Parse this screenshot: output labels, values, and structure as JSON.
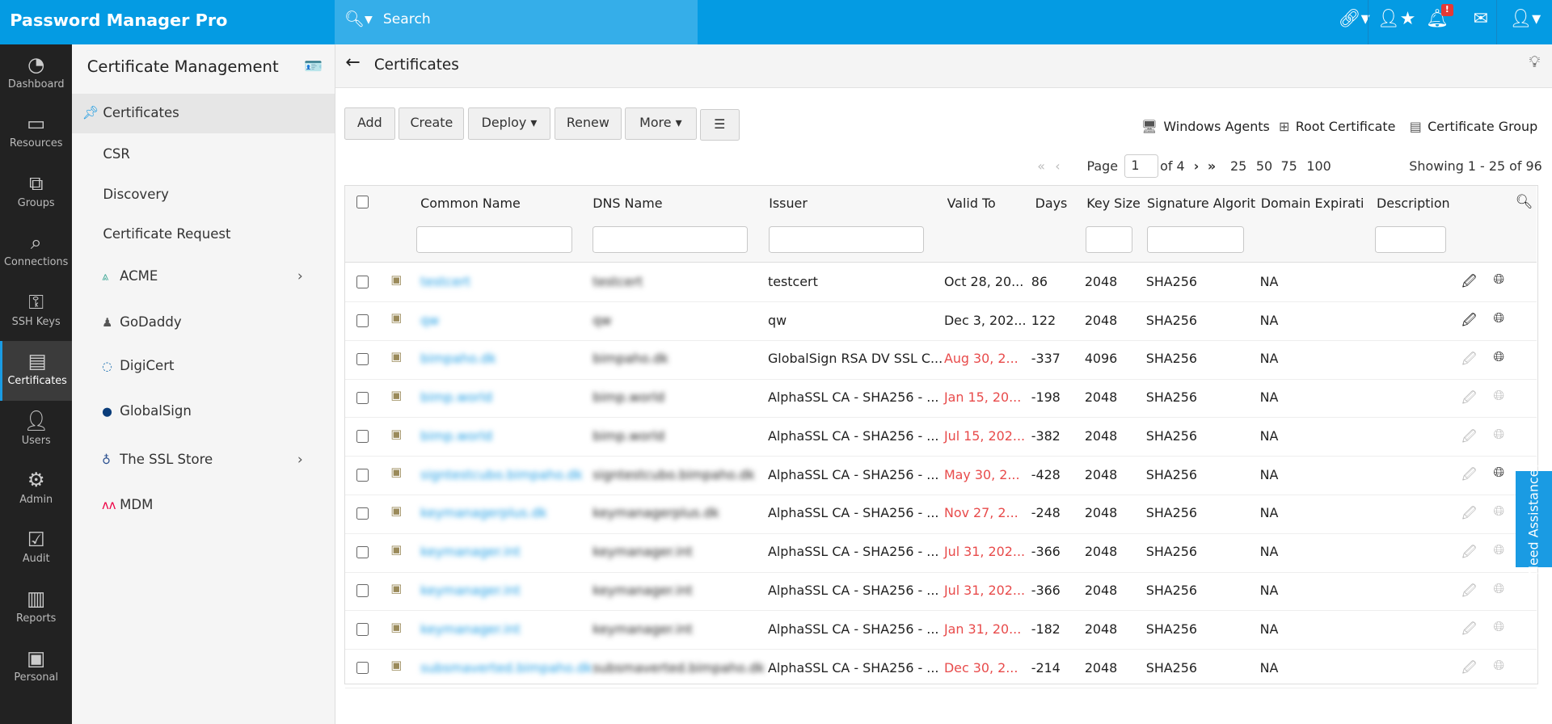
{
  "header": {
    "logo": "Password Manager Pro",
    "search_placeholder": "Search",
    "notification_badge": "!"
  },
  "nav": [
    {
      "label": "Dashboard",
      "icon": "dashboard-icon"
    },
    {
      "label": "Resources",
      "icon": "monitor-icon"
    },
    {
      "label": "Groups",
      "icon": "groups-icon"
    },
    {
      "label": "Connections",
      "icon": "connections-icon"
    },
    {
      "label": "SSH Keys",
      "icon": "ssh-key-icon"
    },
    {
      "label": "Certificates",
      "icon": "certificate-icon",
      "active": true
    },
    {
      "label": "Users",
      "icon": "user-icon"
    },
    {
      "label": "Admin",
      "icon": "gear-icon"
    },
    {
      "label": "Audit",
      "icon": "clipboard-icon"
    },
    {
      "label": "Reports",
      "icon": "bar-chart-icon"
    },
    {
      "label": "Personal",
      "icon": "contact-icon"
    }
  ],
  "sub": {
    "title": "Certificate Management",
    "items": [
      {
        "label": "Certificates"
      },
      {
        "label": "CSR"
      },
      {
        "label": "Discovery"
      },
      {
        "label": "Certificate Request"
      },
      {
        "label": "ACME"
      },
      {
        "label": "GoDaddy"
      },
      {
        "label": "DigiCert"
      },
      {
        "label": "GlobalSign"
      },
      {
        "label": "The SSL Store"
      },
      {
        "label": "MDM"
      }
    ]
  },
  "page": {
    "title": "Certificates"
  },
  "toolbar": {
    "add": "Add",
    "create": "Create",
    "deploy": "Deploy",
    "renew": "Renew",
    "more": "More",
    "windows_agents": "Windows Agents",
    "root_certificate": "Root Certificate",
    "certificate_group": "Certificate Group"
  },
  "pager": {
    "page_label": "Page",
    "page": "1",
    "of": "of 4",
    "sizes": [
      "25",
      "50",
      "75",
      "100"
    ],
    "showing": "Showing 1 - 25 of 96"
  },
  "columns": [
    "Common Name",
    "DNS Name",
    "Issuer",
    "Valid To",
    "Days",
    "Key Size",
    "Signature Algorit",
    "Domain Expirati",
    "Description"
  ],
  "rows": [
    {
      "name": "testcert",
      "dns": "testcert",
      "issuer": "testcert",
      "valid": "Oct 28, 20...",
      "expired": false,
      "days": "86",
      "key": "2048",
      "sig": "SHA256",
      "domain": "NA",
      "active": true
    },
    {
      "name": "qw",
      "dns": "qw",
      "issuer": "qw",
      "valid": "Dec 3, 202...",
      "expired": false,
      "days": "122",
      "key": "2048",
      "sig": "SHA256",
      "domain": "NA",
      "active": true
    },
    {
      "name": "bimpaho.dk",
      "dns": "bimpaho.dk",
      "issuer": "GlobalSign RSA DV SSL C...",
      "valid": "Aug 30, 2...",
      "expired": true,
      "days": "-337",
      "key": "4096",
      "sig": "SHA256",
      "domain": "NA",
      "active": false,
      "deploy": true
    },
    {
      "name": "bimp.world",
      "dns": "bimp.world",
      "issuer": "AlphaSSL CA - SHA256 - ...",
      "valid": "Jan 15, 20...",
      "expired": true,
      "days": "-198",
      "key": "2048",
      "sig": "SHA256",
      "domain": "NA",
      "active": false
    },
    {
      "name": "bimp.world",
      "dns": "bimp.world",
      "issuer": "AlphaSSL CA - SHA256 - ...",
      "valid": "Jul 15, 202...",
      "expired": true,
      "days": "-382",
      "key": "2048",
      "sig": "SHA256",
      "domain": "NA",
      "active": false
    },
    {
      "name": "signtestcubo.bimpaho.dk",
      "dns": "signtestcubo.bimpaho.dk",
      "issuer": "AlphaSSL CA - SHA256 - ...",
      "valid": "May 30, 2...",
      "expired": true,
      "days": "-428",
      "key": "2048",
      "sig": "SHA256",
      "domain": "NA",
      "active": false,
      "deploy": true
    },
    {
      "name": "keymanagerplus.dk",
      "dns": "keymanagerplus.dk",
      "issuer": "AlphaSSL CA - SHA256 - ...",
      "valid": "Nov 27, 2...",
      "expired": true,
      "days": "-248",
      "key": "2048",
      "sig": "SHA256",
      "domain": "NA",
      "active": false
    },
    {
      "name": "keymanager.int",
      "dns": "keymanager.int",
      "issuer": "AlphaSSL CA - SHA256 - ...",
      "valid": "Jul 31, 202...",
      "expired": true,
      "days": "-366",
      "key": "2048",
      "sig": "SHA256",
      "domain": "NA",
      "active": false
    },
    {
      "name": "keymanager.int",
      "dns": "keymanager.int",
      "issuer": "AlphaSSL CA - SHA256 - ...",
      "valid": "Jul 31, 202...",
      "expired": true,
      "days": "-366",
      "key": "2048",
      "sig": "SHA256",
      "domain": "NA",
      "active": false
    },
    {
      "name": "keymanager.int",
      "dns": "keymanager.int",
      "issuer": "AlphaSSL CA - SHA256 - ...",
      "valid": "Jan 31, 20...",
      "expired": true,
      "days": "-182",
      "key": "2048",
      "sig": "SHA256",
      "domain": "NA",
      "active": false
    },
    {
      "name": "subsmaverted.bimpaho.dk",
      "dns": "subsmaverted.bimpaho.dk",
      "issuer": "AlphaSSL CA - SHA256 - ...",
      "valid": "Dec 30, 2...",
      "expired": true,
      "days": "-214",
      "key": "2048",
      "sig": "SHA256",
      "domain": "NA",
      "active": false
    }
  ],
  "assist": "Need Assistance?",
  "colors": {
    "brand": "#049be3",
    "expired": "#e84b4b",
    "link": "#1a9be3"
  }
}
